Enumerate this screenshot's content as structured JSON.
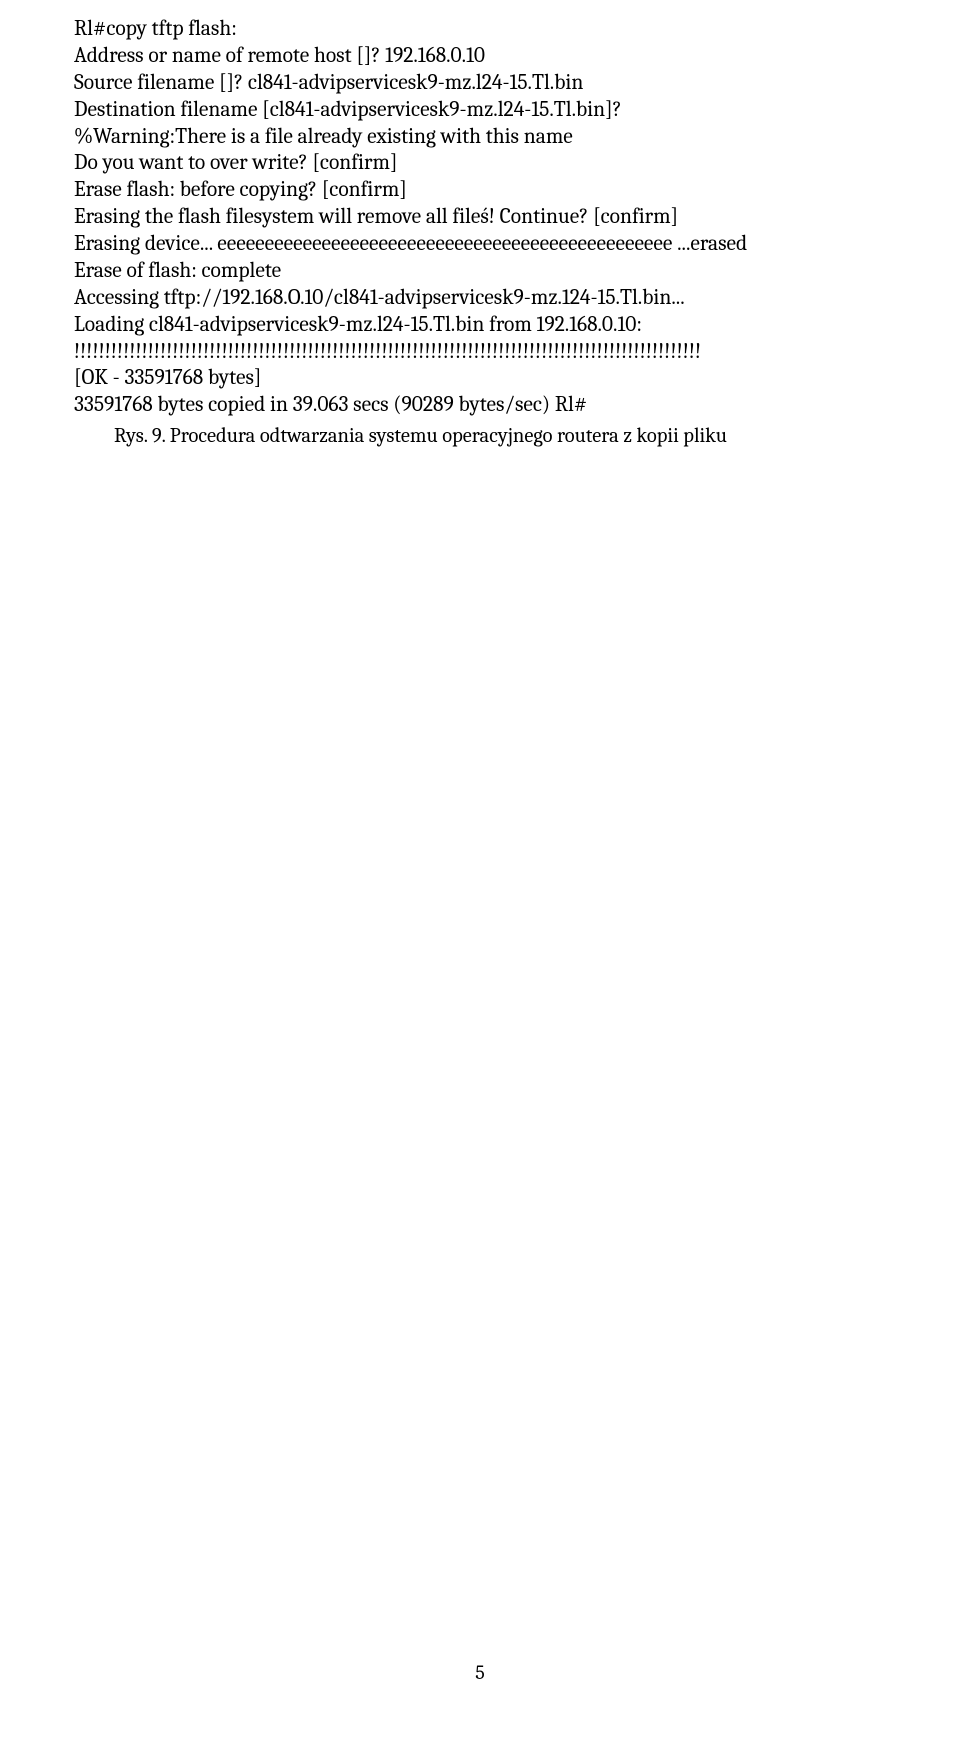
{
  "terminal": {
    "l1": "Rl#copy tftp flash:",
    "l2": "Address or name of remote host []? 192.168.0.10",
    "l3": "Source filename []? cl841-advipservicesk9-mz.l24-15.Tl.bin",
    "l4": "Destination filename [cl841-advipservicesk9-mz.l24-15.Tl.bin]?",
    "l5": "%Warning:There is a file already existing with this name",
    "l6": "Do you want to over write? [confirm]",
    "l7": "Erase flash: before copying? [confirm]",
    "l8": "Erasing the flash filesystem will remove all fileś! Continue? [confirm]",
    "l9": "Erasing device... eeeeeeeeeeeeeeeeeeeeeeeeeeeeeeeeeeeeeeeeeeeeeeee ...erased",
    "l10": "Erase of flash: complete",
    "l11": "Accessing tftp://192.168.O.10/cl841-advipservicesk9-mz.124-15.Tl.bin...",
    "l12": "Loading cl841-advipservicesk9-mz.l24-15.Tl.bin from 192.168.0.10:",
    "l13": "!!!!!!!!!!!!!!!!!!!!!!!!!!!!!!!!!!!!!!!!!!!!!!!!!!!!!!!!!!!!!!!!!!!!!!!!!!!!!!!!!!!!!!!!!!!!!!!!!!!!!!",
    "l14": "[OK - 33591768 bytes]",
    "l15": "33591768 bytes copied in 39.063 secs (90289 bytes/sec) Rl#"
  },
  "caption": "Rys. 9. Procedura odtwarzania systemu operacyjnego routera z kopii pliku",
  "pagenum": "5"
}
